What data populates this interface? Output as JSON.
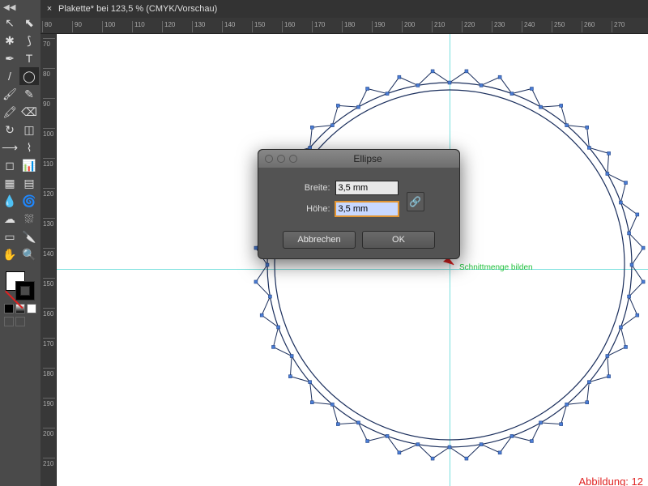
{
  "tab": {
    "close": "×",
    "title": "Plakette* bei 123,5 % (CMYK/Vorschau)"
  },
  "toolbar_handle": "◀◀",
  "ruler_h_ticks": [
    "80",
    "90",
    "100",
    "110",
    "120",
    "130",
    "140",
    "150",
    "160",
    "170",
    "180",
    "190",
    "200",
    "210",
    "220",
    "230",
    "240",
    "250",
    "260",
    "270"
  ],
  "ruler_v_ticks": [
    "70",
    "80",
    "90",
    "100",
    "110",
    "120",
    "130",
    "140",
    "150",
    "160",
    "170",
    "180",
    "190",
    "200",
    "210"
  ],
  "tooltip": "Schnittmenge bilden",
  "figure_label": "Abbildung: 12",
  "dialog": {
    "title": "Ellipse",
    "width_label": "Breite:",
    "height_label": "Höhe:",
    "width_value": "3,5 mm",
    "height_value": "3,5 mm",
    "cancel": "Abbrechen",
    "ok": "OK",
    "link_icon": "🔗"
  },
  "tools": {
    "selection": "↖",
    "direct": "⬉",
    "magic": "✱",
    "lasso": "⟆",
    "pen": "✒",
    "type": "T",
    "line": "/",
    "ellipse": "◯",
    "brush": "🖌",
    "pencil": "✎",
    "blob": "🖍",
    "eraser": "⌫",
    "rotate": "↻",
    "scale": "◫",
    "width": "⟶",
    "warp": "⌇",
    "shape": "◻",
    "graph": "📊",
    "mesh": "▦",
    "grad": "▤",
    "eyedrop": "💧",
    "blend": "🌀",
    "symbol": "☁",
    "spray": "⛆",
    "artb": "▭",
    "slice": "🔪",
    "hand": "✋",
    "zoom": "🔍"
  }
}
